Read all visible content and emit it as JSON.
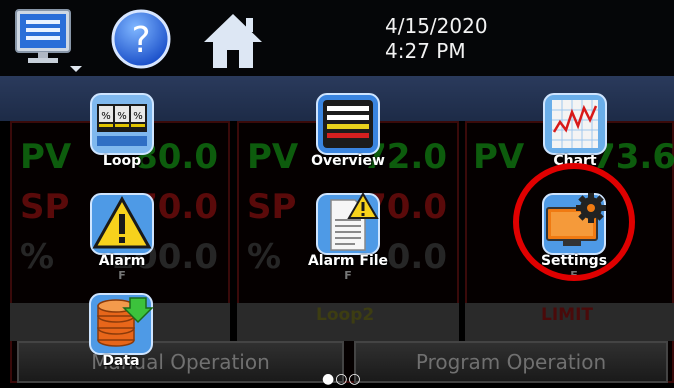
{
  "header": {
    "date": "4/15/2020",
    "time": "4:27 PM"
  },
  "loops": [
    {
      "pv_label": "PV",
      "pv_value": "80.0",
      "sp_label": "SP",
      "sp_value": "70.0",
      "pct_label": "%",
      "pct_value": "100.0",
      "unit": "F",
      "name": ""
    },
    {
      "pv_label": "PV",
      "pv_value": "72.0",
      "sp_label": "SP",
      "sp_value": "70.0",
      "pct_label": "%",
      "pct_value": "0.0",
      "unit": "F",
      "name": "Loop2"
    },
    {
      "pv_label": "PV",
      "pv_value": "73.6",
      "sp_label": "",
      "sp_value": "",
      "pct_label": "",
      "pct_value": "",
      "unit": "F",
      "name": "LIMIT"
    }
  ],
  "modes": {
    "manual": "Manual Operation",
    "program": "Program Operation"
  },
  "menu": {
    "loop": "Loop",
    "overview": "Overview",
    "chart": "Chart",
    "alarm": "Alarm",
    "alarm_file": "Alarm File",
    "settings": "Settings",
    "data": "Data"
  },
  "pager": {
    "dots": "●○○"
  },
  "colors": {
    "pv": "#0d5c0d",
    "sp": "#5a0a0a",
    "highlight": "#e00000",
    "band": "#24334f"
  }
}
